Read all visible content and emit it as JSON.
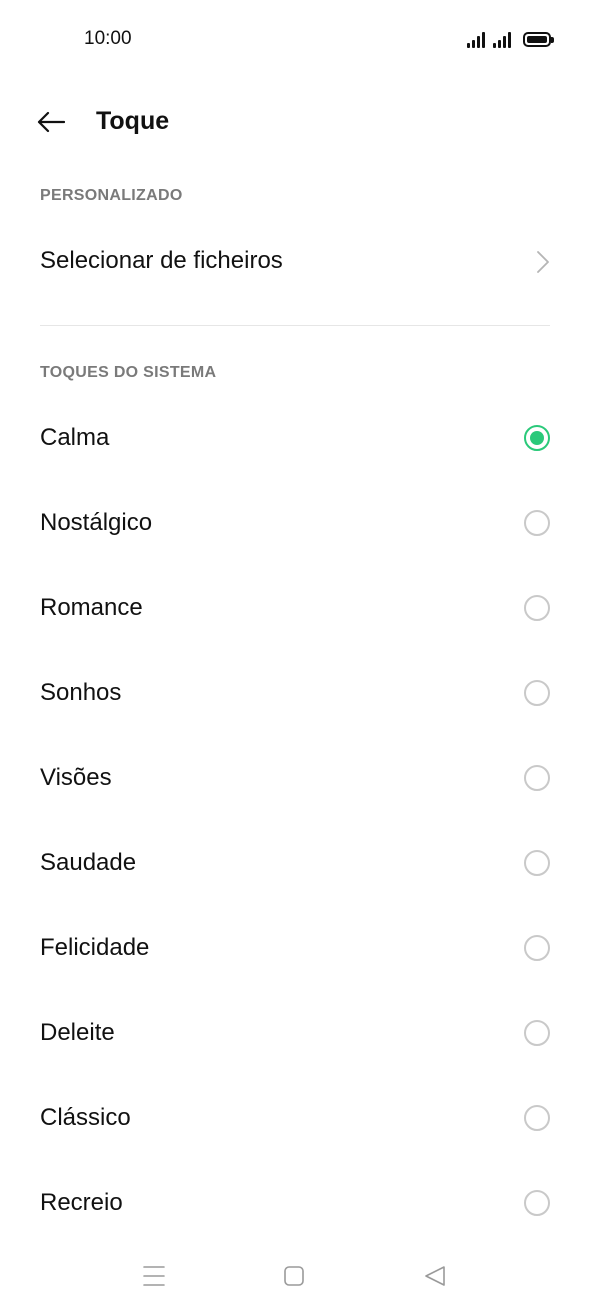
{
  "status_bar": {
    "time": "10:00",
    "icons": [
      "signal-icon",
      "signal-icon",
      "battery-icon"
    ]
  },
  "header": {
    "back_icon": "back-arrow-icon",
    "title": "Toque"
  },
  "custom_section": {
    "label": "PERSONALIZADO",
    "file_row_label": "Selecionar de ficheiros",
    "chevron_icon": "chevron-right-icon"
  },
  "system_section": {
    "label": "TOQUES DO SISTEMA",
    "selected": "Calma",
    "accent_color": "#2ac97a",
    "items": [
      {
        "label": "Calma",
        "checked": true
      },
      {
        "label": "Nostálgico",
        "checked": false
      },
      {
        "label": "Romance",
        "checked": false
      },
      {
        "label": "Sonhos",
        "checked": false
      },
      {
        "label": "Visões",
        "checked": false
      },
      {
        "label": "Saudade",
        "checked": false
      },
      {
        "label": "Felicidade",
        "checked": false
      },
      {
        "label": "Deleite",
        "checked": false
      },
      {
        "label": "Clássico",
        "checked": false
      },
      {
        "label": "Recreio",
        "checked": false
      }
    ]
  },
  "nav_bar": {
    "icons": [
      "menu-icon",
      "home-icon",
      "back-triangle-icon"
    ]
  }
}
